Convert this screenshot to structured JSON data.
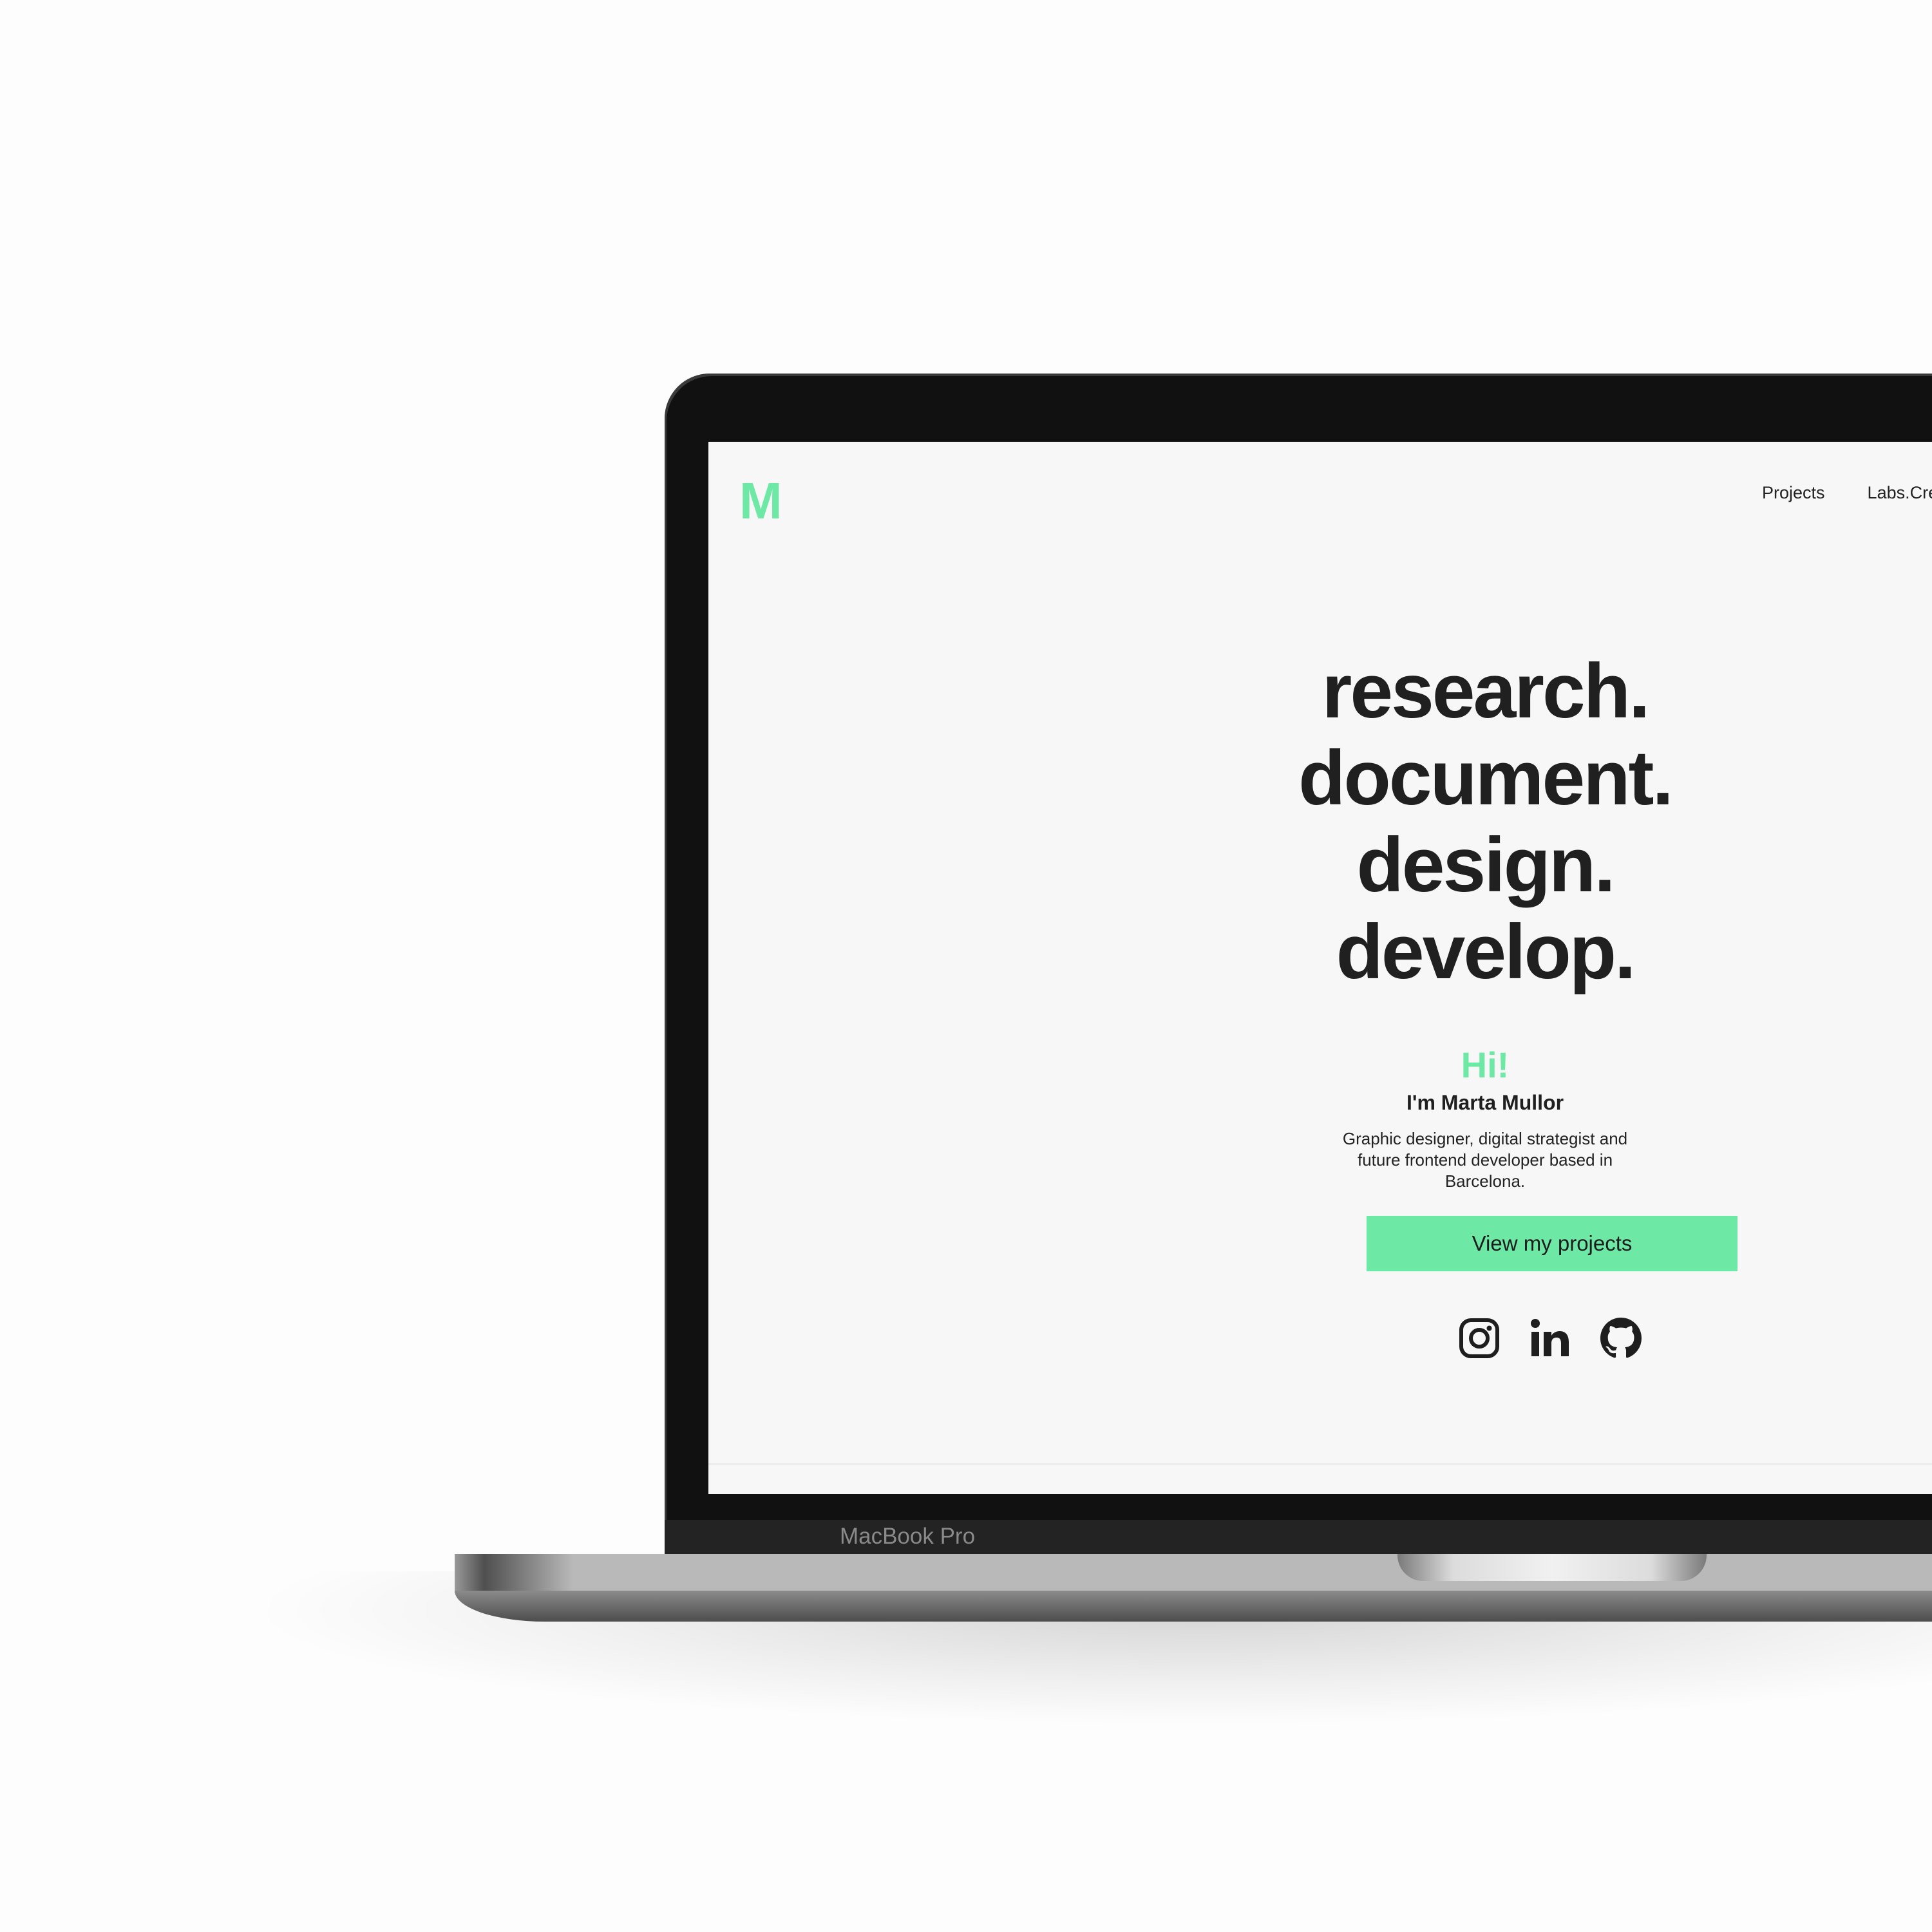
{
  "device": {
    "label": "MacBook Pro"
  },
  "site": {
    "logo": "M",
    "nav": [
      {
        "label": "Projects"
      },
      {
        "label": "Labs.Cre"
      }
    ],
    "headline": [
      "research.",
      "document.",
      "design.",
      "develop."
    ],
    "greeting": "Hi!",
    "name": "I'm Marta Mullor",
    "bio": "Graphic designer, digital strategist and future frontend developer based in Barcelona.",
    "cta_label": "View my projects",
    "social_icons": [
      "instagram-icon",
      "linkedin-icon",
      "github-icon"
    ],
    "accent_color": "#6ee9a5",
    "text_color": "#202020",
    "background_color": "#f7f7f7"
  }
}
